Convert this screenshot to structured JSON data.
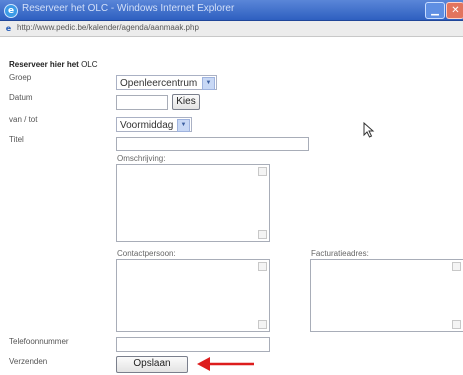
{
  "window": {
    "title": "Reserveer het OLC - Windows Internet Explorer",
    "address": "http://www.pedic.be/kalender/agenda/aanmaak.php"
  },
  "form": {
    "heading_prefix": "Reserveer hier het",
    "heading_suffix": "OLC",
    "labels": {
      "groep": "Groep",
      "datum": "Datum",
      "van_tot": "van / tot",
      "titel": "Titel",
      "telefoonnummer": "Telefoonnummer",
      "verzenden": "Verzenden"
    },
    "groep_value": "Openleercentrum",
    "van_tot_value": "Voormiddag",
    "kies_label": "Kies",
    "omschrijving_label": "Omschrijving:",
    "contactpersoon_label": "Contactpersoon:",
    "facturatieadres_label": "Facturatieadres:",
    "opslaan_label": "Opslaan"
  },
  "colors": {
    "titlebar": "#2e5fc0",
    "annotation_arrow": "#dd1d1d"
  }
}
